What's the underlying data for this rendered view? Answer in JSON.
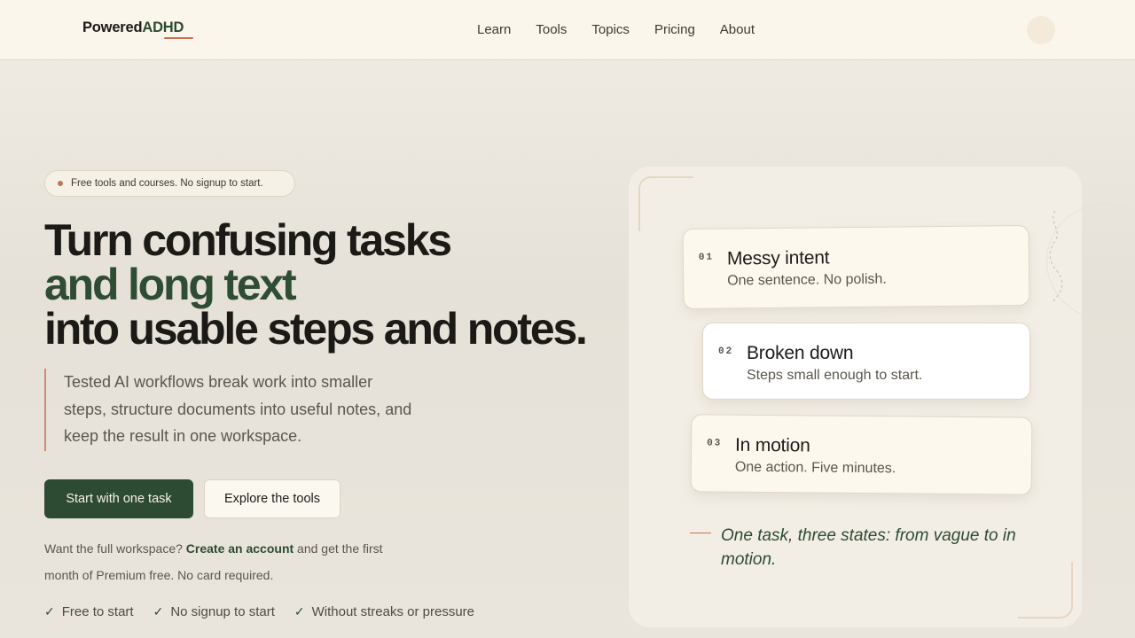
{
  "header": {
    "logo_primary": "Powered",
    "logo_accent": "ADHD",
    "nav": [
      "Learn",
      "Tools",
      "Topics",
      "Pricing",
      "About"
    ]
  },
  "hero": {
    "badge": "Free tools and courses. No signup to start.",
    "headline_line1": "Turn confusing tasks",
    "headline_line2": "and long text",
    "headline_line3": "into usable steps and notes.",
    "lede": "Tested AI workflows break work into smaller steps, structure documents into useful notes, and keep the result in one workspace.",
    "primary_button": "Start with one task",
    "secondary_button": "Explore the tools",
    "signup_prefix": "Want the full workspace?",
    "signup_link": "Create an account",
    "signup_suffix": "and get the first month of Premium free. No card required.",
    "checks": [
      "Free to start",
      "No signup to start",
      "Without streaks or pressure"
    ]
  },
  "panel": {
    "cards": [
      {
        "num": "01",
        "title": "Messy intent",
        "sub": "One sentence. No polish."
      },
      {
        "num": "02",
        "title": "Broken down",
        "sub": "Steps small enough to start."
      },
      {
        "num": "03",
        "title": "In motion",
        "sub": "One action. Five minutes."
      }
    ],
    "caption": "One task, three states: from vague to in motion."
  },
  "colors": {
    "brand_green": "#2d4a33",
    "accent_terracotta": "#c9704e",
    "header_bg": "#faf6ec"
  }
}
